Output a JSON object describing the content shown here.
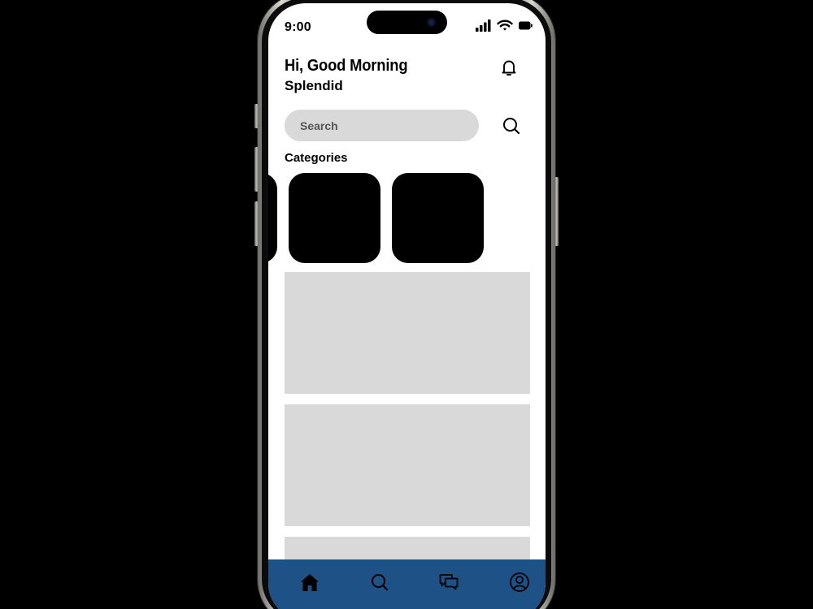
{
  "status_bar": {
    "time": "9:00"
  },
  "header": {
    "greeting": "Hi, Good Morning",
    "user_name": "Splendid",
    "notification_icon": "bell-icon"
  },
  "search": {
    "placeholder": "Search",
    "value": "",
    "icon": "search-icon"
  },
  "categories": {
    "title": "Categories",
    "items": [
      {
        "icon": "category-tile"
      },
      {
        "icon": "category-tile"
      },
      {
        "icon": "category-tile"
      }
    ]
  },
  "content_cards": [
    {
      "kind": "placeholder"
    },
    {
      "kind": "placeholder"
    },
    {
      "kind": "placeholder"
    }
  ],
  "bottom_nav": {
    "items": [
      {
        "icon": "home-icon",
        "active": true
      },
      {
        "icon": "search-icon",
        "active": false
      },
      {
        "icon": "chat-icon",
        "active": false
      },
      {
        "icon": "profile-icon",
        "active": false
      }
    ]
  },
  "colors": {
    "background": "#000000",
    "screen": "#ffffff",
    "placeholder": "#d9d9d9",
    "nav_bar": "#1e5185",
    "category_tile": "#000000",
    "text": "#000000"
  }
}
